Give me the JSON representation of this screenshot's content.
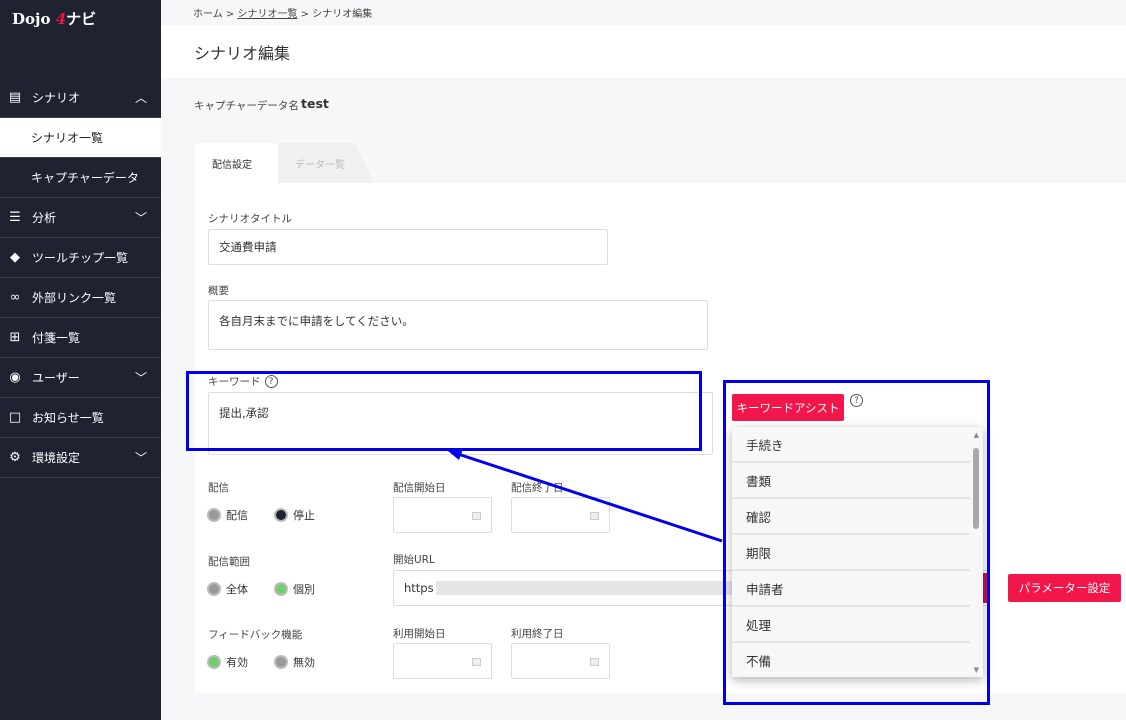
{
  "brand": {
    "logo": "Dojo 4ナビ",
    "logo_left": "Dojo",
    "logo_four": "4",
    "logo_right": "ナビ"
  },
  "sidebar": {
    "items": [
      {
        "label": "シナリオ",
        "icon": "document-icon",
        "chevron": "up"
      },
      {
        "label": "シナリオ一覧",
        "active": true
      },
      {
        "label": "キャプチャーデータ"
      },
      {
        "label": "分析",
        "icon": "analysis-icon",
        "chevron": "down"
      },
      {
        "label": "ツールチップ一覧",
        "icon": "tag-icon"
      },
      {
        "label": "外部リンク一覧",
        "icon": "link-icon"
      },
      {
        "label": "付箋一覧",
        "icon": "sticky-note-icon"
      },
      {
        "label": "ユーザー",
        "icon": "user-icon",
        "chevron": "down"
      },
      {
        "label": "お知らせ一覧",
        "icon": "notice-icon"
      },
      {
        "label": "環境設定",
        "icon": "gear-icon",
        "chevron": "down"
      }
    ]
  },
  "breadcrumb": [
    "ホーム",
    "シナリオ一覧",
    "シナリオ編集"
  ],
  "page_title": "シナリオ編集",
  "capture": {
    "label": "キャプチャーデータ名",
    "value": "test"
  },
  "tabs": [
    {
      "label": "配信設定",
      "active": true
    },
    {
      "label": "データ一覧",
      "active": false
    }
  ],
  "form": {
    "title_label": "シナリオタイトル",
    "title_value": "交通費申請",
    "summary_label": "概要",
    "summary_value": "各自月末までに申請をしてください。",
    "keyword_label": "キーワード",
    "keyword_value": "提出,承認",
    "delivery_label": "配信",
    "delivery_options": [
      "配信",
      "停止"
    ],
    "delivery_selected": "停止",
    "delivery_start_label": "配信開始日",
    "delivery_end_label": "配信終了日",
    "scope_label": "配信範囲",
    "scope_options": [
      "全体",
      "個別"
    ],
    "scope_selected": "個別",
    "url_label": "開始URL",
    "url_value": "https",
    "param_button": "パラメーター設定",
    "feedback_label": "フィードバック機能",
    "feedback_options": [
      "有効",
      "無効"
    ],
    "feedback_selected": "有効",
    "use_start_label": "利用開始日",
    "use_end_label": "利用終了日"
  },
  "keyword_assist": {
    "button": "キーワードアシスト",
    "help": "?",
    "items": [
      "手続き",
      "書類",
      "確認",
      "期限",
      "申請者",
      "処理",
      "不備"
    ]
  },
  "colors": {
    "sidebar": "#1e2231",
    "accent": "#f2164a",
    "highlight": "#0000ee",
    "radio_on_green": "#6fcf6a",
    "radio_on_dark": "#1e2231"
  }
}
